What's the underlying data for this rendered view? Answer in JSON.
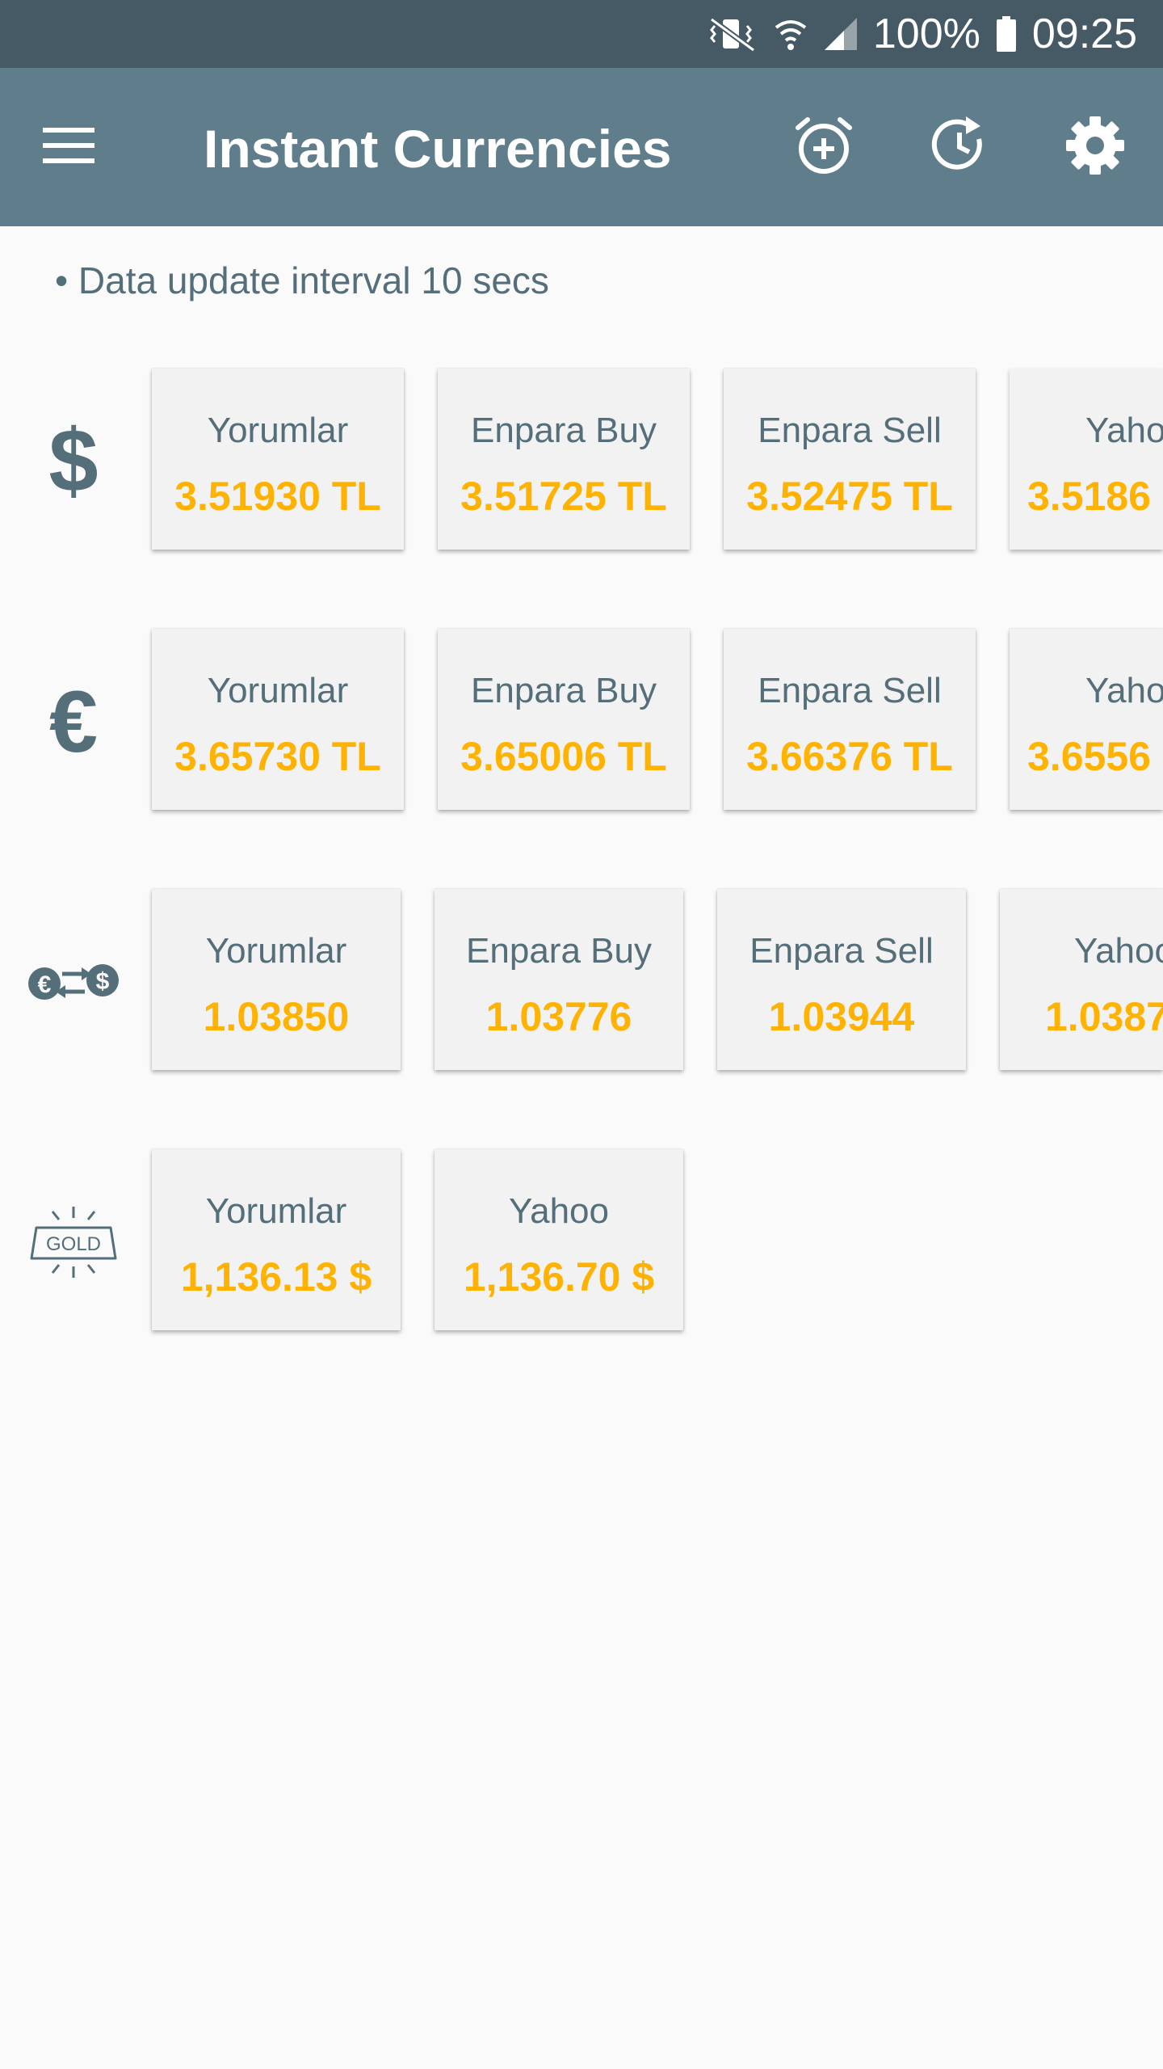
{
  "status_bar": {
    "battery": "100%",
    "time": "09:25"
  },
  "app_bar": {
    "title": "Instant Currencies",
    "icons": [
      "menu-icon",
      "alarm-add-icon",
      "history-icon",
      "settings-gear-icon"
    ]
  },
  "info": {
    "interval_text": "• Data update interval 10 secs"
  },
  "rows": [
    {
      "icon": "dollar-icon",
      "cards": [
        {
          "source": "Yorumlar",
          "value": "3.51930 TL"
        },
        {
          "source": "Enpara Buy",
          "value": "3.51725 TL"
        },
        {
          "source": "Enpara Sell",
          "value": "3.52475 TL"
        },
        {
          "source": "Yaho",
          "value": "3.5186"
        }
      ]
    },
    {
      "icon": "euro-icon",
      "cards": [
        {
          "source": "Yorumlar",
          "value": "3.65730 TL"
        },
        {
          "source": "Enpara Buy",
          "value": "3.65006 TL"
        },
        {
          "source": "Enpara Sell",
          "value": "3.66376 TL"
        },
        {
          "source": "Yaho",
          "value": "3.6556"
        }
      ]
    },
    {
      "icon": "euro-dollar-exchange-icon",
      "cards": [
        {
          "source": "Yorumlar",
          "value": "1.03850"
        },
        {
          "source": "Enpara Buy",
          "value": "1.03776"
        },
        {
          "source": "Enpara Sell",
          "value": "1.03944"
        },
        {
          "source": "Yahoo",
          "value": "1.0387"
        }
      ]
    },
    {
      "icon": "gold-bar-icon",
      "icon_text": "GOLD",
      "cards": [
        {
          "source": "Yorumlar",
          "value": "1,136.13 $"
        },
        {
          "source": "Yahoo",
          "value": "1,136.70 $"
        }
      ]
    }
  ],
  "colors": {
    "status_bar": "#455a64",
    "app_bar": "#607d8b",
    "value_accent": "#ffb300",
    "label_text": "#546e7a",
    "card_bg": "#f2f2f2",
    "page_bg": "#fafafa"
  }
}
